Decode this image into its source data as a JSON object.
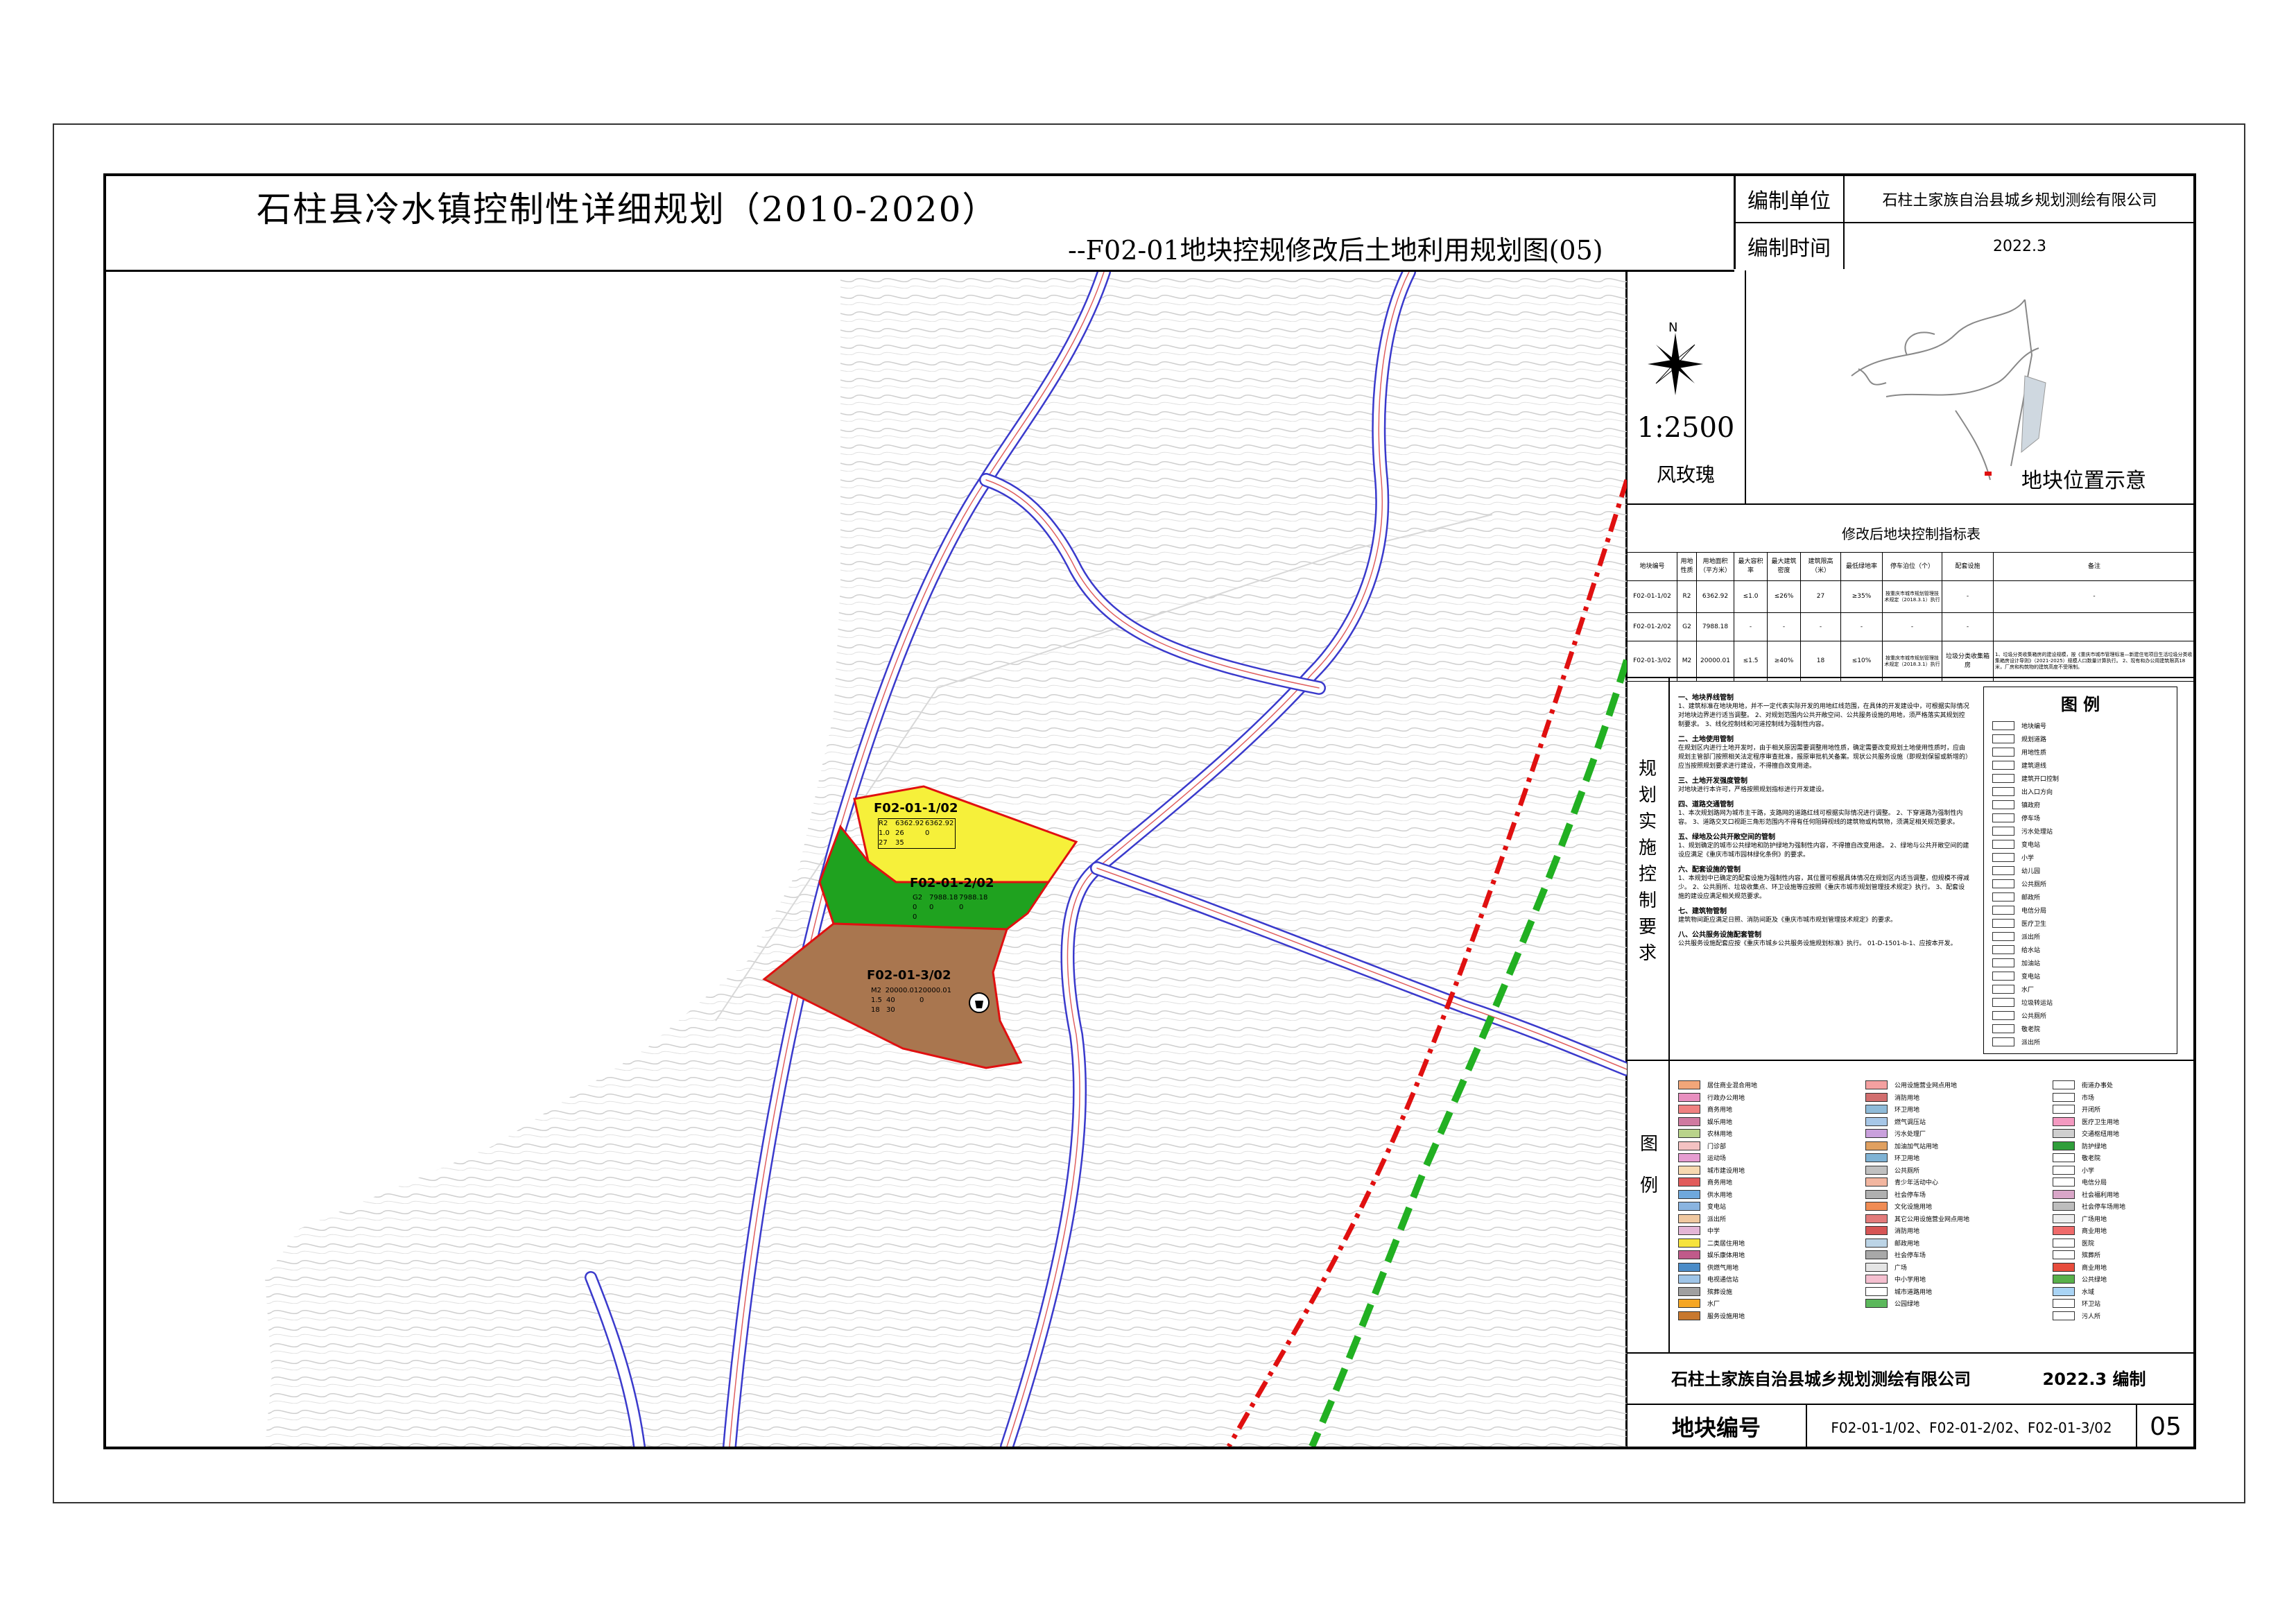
{
  "header": {
    "title": "石柱县冷水镇控制性详细规划（2010-2020）",
    "subtitle": "--F02-01地块控规修改后土地利用规划图(05)",
    "unit_label": "编制单位",
    "unit_value": "石柱土家族自治县城乡规划测绘有限公司",
    "time_label": "编制时间",
    "time_value": "2022.3"
  },
  "compass": {
    "north": "N",
    "scale": "1:2500",
    "label": "风玫瑰"
  },
  "location": {
    "label": "地块位置示意"
  },
  "index_table": {
    "title": "修改后地块控制指标表",
    "headers": [
      "地块编号",
      "用地性质",
      "用地面积（平方米）",
      "最大容积率",
      "最大建筑密度",
      "建筑限高（米）",
      "最低绿地率",
      "停车泊位（个）",
      "配套设施",
      "备注"
    ],
    "rows": [
      [
        "F02-01-1/02",
        "R2",
        "6362.92",
        "≤1.0",
        "≤26%",
        "27",
        "≥35%",
        "按重庆市城市规划管理技术规定（2018.3.1）执行",
        "-",
        "-"
      ],
      [
        "F02-01-2/02",
        "G2",
        "7988.18",
        "-",
        "-",
        "-",
        "-",
        "-",
        "-",
        ""
      ],
      [
        "F02-01-3/02",
        "M2",
        "20000.01",
        "≤1.5",
        "≥40%",
        "18",
        "≤10%",
        "按重庆市城市规划管理技术规定（2018.3.1）执行",
        "垃圾分类收集箱房",
        "1、垃圾分类收集箱房的建设规模，按《重庆市城市管理标准—新建住宅项目生活垃圾分类收集箱房设计导则》（2021-2025）规模人口数量计算执行。 2、现有和办公用建筑限高18米，厂房和构筑物的建筑高度不受限制。"
      ]
    ]
  },
  "requirements": {
    "title": "规划实施控制要求",
    "sections": [
      {
        "h": "一、地块界线管制",
        "t": "1、建筑标准在地块用地，并不一定代表实际开发的用地红线范围，在具体的开发建设中，可根据实际情况对地块边界进行适当调整。 2、对规划范围内公共开敞空间、公共服务设施的用地，须严格落实其规划控制要求。 3、线化控制线和河道控制线为强制性内容。"
      },
      {
        "h": "二、土地使用管制",
        "t": "在规划区内进行土地开发时，由于相关原因需要调整用地性质，确定需要改变规划土地使用性质时，应由规划主管部门按照相关法定程序审查批准，报原审批机关备案。现状公共服务设施（即规划保留或新增的）应当按照规划要求进行建设，不得擅自改变用途。"
      },
      {
        "h": "三、土地开发强度管制",
        "t": "对地块进行本许可，严格按照规划指标进行开发建设。"
      },
      {
        "h": "四、道路交通管制",
        "t": "1、本次规划路网为城市主干路，支路网的道路红线可根据实际情况进行调整。 2、下穿道路为强制性内容。 3、道路交叉口视距三角形范围内不得有任何阻碍视线的建筑物或构筑物，须满足相关规范要求。"
      },
      {
        "h": "五、绿地及公共开敞空间的管制",
        "t": "1、规划确定的城市公共绿地和防护绿地为强制性内容，不得擅自改变用途。 2、绿地与公共开敞空间的建设应满足《重庆市城市园林绿化条例》的要求。"
      },
      {
        "h": "六、配套设施的管制",
        "t": "1、本规划中已确定的配套设施为强制性内容，其位置可根据具体情况在规划区内适当调整，但规模不得减少。 2、公共厕所、垃圾收集点、环卫设施等应按照《重庆市城市规划管理技术规定》执行。 3、配套设施的建设应满足相关规范要求。"
      },
      {
        "h": "七、建筑物管制",
        "t": "建筑物间距应满足日照、消防间距及《重庆市城市规划管理技术规定》的要求。"
      },
      {
        "h": "八、公共服务设施配套管制",
        "t": "公共服务设施配套应按《重庆市城乡公共服务设施规划标准》执行。 01-D-1501-b-1、应按本开发。"
      }
    ]
  },
  "legend_top": {
    "title": "图  例",
    "items": [
      "地块编号",
      "规划道路",
      "用地性质",
      "建筑退线",
      "建筑开口控制",
      "出入口方向",
      "镇政府",
      "停车场",
      "污水处理站",
      "变电站",
      "小学",
      "幼儿园",
      "公共厕所",
      "邮政所",
      "电信分局",
      "医疗卫生",
      "派出所",
      "给水站",
      "加油站",
      "变电站",
      "水厂",
      "垃圾转运站",
      "公共厕所",
      "敬老院",
      "派出所"
    ]
  },
  "legend_bottom": {
    "title": "图    例",
    "col1": [
      {
        "label": "居住商业混合用地",
        "color": "#f2a679"
      },
      {
        "label": "行政办公用地",
        "color": "#e88fbf"
      },
      {
        "label": "商务用地",
        "color": "#f08080"
      },
      {
        "label": "娱乐用地",
        "color": "#d07aa0"
      },
      {
        "label": "农林用地",
        "color": "#b9d38a"
      },
      {
        "label": "门诊部",
        "color": "#f4c2c2"
      },
      {
        "label": "运动场",
        "color": "#e69dd1"
      },
      {
        "label": "城市建设用地",
        "color": "#f7d9b0"
      },
      {
        "label": "商务用地",
        "color": "#e15b5b"
      },
      {
        "label": "供水用地",
        "color": "#6fa8dc"
      },
      {
        "label": "变电站",
        "color": "#8ab4e0"
      },
      {
        "label": "派出所",
        "color": "#f0c8a0"
      },
      {
        "label": "中学",
        "color": "#e4b5d6"
      },
      {
        "label": "二类居住用地",
        "color": "#f6e33c"
      },
      {
        "label": "娱乐康体用地",
        "color": "#c05a8a"
      },
      {
        "label": "供燃气用地",
        "color": "#4b8cc8"
      },
      {
        "label": "电视通信站",
        "color": "#9fc5e8"
      },
      {
        "label": "殡葬设施",
        "color": "#a0a0a0"
      },
      {
        "label": "水厂",
        "color": "#f5a623"
      },
      {
        "label": "服务设施用地",
        "color": "#c8782e"
      }
    ],
    "col2": [
      {
        "label": "公用设施营业网点用地",
        "color": "#f4a0a0"
      },
      {
        "label": "消防用地",
        "color": "#d26e6e"
      },
      {
        "label": "环卫用地",
        "color": "#8fbbd9"
      },
      {
        "label": "燃气调压站",
        "color": "#a7c7e7"
      },
      {
        "label": "污水处理厂",
        "color": "#c9a0dc"
      },
      {
        "label": "加油加气站用地",
        "color": "#e0a060"
      },
      {
        "label": "环卫用地",
        "color": "#7fb3d5"
      },
      {
        "label": "公共厕所",
        "color": "#c0c0c0"
      },
      {
        "label": "青少年活动中心",
        "color": "#f2b6a0"
      },
      {
        "label": "社会停车场",
        "color": "#b0b0b0"
      },
      {
        "label": "文化设施用地",
        "color": "#f08c54"
      },
      {
        "label": "其它公用设施营业网点用地",
        "color": "#e37b7b"
      },
      {
        "label": "消防用地",
        "color": "#d65555"
      },
      {
        "label": "邮政用地",
        "color": "#bcd4e6"
      },
      {
        "label": "社会停车场",
        "color": "#a8a8a8"
      },
      {
        "label": "广场",
        "color": "#e5e5e5"
      },
      {
        "label": "中小学用地",
        "color": "#f5c0d0"
      },
      {
        "label": "城市道路用地",
        "color": "#ffffff"
      },
      {
        "label": "公园绿地",
        "color": "#5cb85c"
      }
    ],
    "col3": [
      {
        "label": "街道办事处",
        "color": "#ffffff"
      },
      {
        "label": "市场",
        "color": "#ffffff"
      },
      {
        "label": "开闭所",
        "color": "#ffffff"
      },
      {
        "label": "医疗卫生用地",
        "color": "#f49ac1"
      },
      {
        "label": "交通枢纽用地",
        "color": "#cfcfcf"
      },
      {
        "label": "防护绿地",
        "color": "#2f9e3a"
      },
      {
        "label": "敬老院",
        "color": "#ffffff"
      },
      {
        "label": "小学",
        "color": "#ffffff"
      },
      {
        "label": "电信分局",
        "color": "#ffffff"
      },
      {
        "label": "社会福利用地",
        "color": "#d9a6c8"
      },
      {
        "label": "社会停车场用地",
        "color": "#bdbdbd"
      },
      {
        "label": "广场用地",
        "color": "#eeeeee"
      },
      {
        "label": "商业用地",
        "color": "#ef6a6a"
      },
      {
        "label": "医院",
        "color": "#ffffff"
      },
      {
        "label": "殡葬所",
        "color": "#ffffff"
      },
      {
        "label": "商业用地",
        "color": "#e74c3c"
      },
      {
        "label": "公共绿地",
        "color": "#58b04a"
      },
      {
        "label": "水域",
        "color": "#a9d4f5"
      },
      {
        "label": "环卫站",
        "color": "#ffffff"
      },
      {
        "label": "污人所",
        "color": "#ffffff"
      }
    ]
  },
  "footer": {
    "company": "石柱土家族自治县城乡规划测绘有限公司",
    "date_note": "2022.3 编制",
    "plot_label": "地块编号",
    "plot_value": "F02-01-1/02、F02-01-2/02、F02-01-3/02",
    "sheet": "05"
  },
  "parcels": [
    {
      "id": "F02-01-1/02",
      "code": "R2",
      "area1": "6362.92",
      "area2": "6362.92",
      "far": "1.0",
      "density": "26",
      "d0": "0",
      "height": "27",
      "green": "35"
    },
    {
      "id": "F02-01-2/02",
      "code": "G2",
      "area1": "7988.18",
      "area2": "7988.18",
      "a": "0",
      "b": "0",
      "c": "0",
      "d": "0"
    },
    {
      "id": "F02-01-3/02",
      "code": "M2",
      "area1": "20000.01",
      "area2": "20000.01",
      "far": "1.5",
      "density": "40",
      "d0": "0",
      "height": "18",
      "green": "30"
    }
  ],
  "colors": {
    "residential": "#f6f03a",
    "green": "#1fa21f",
    "industrial": "#a9764f",
    "road": "#3a3acc",
    "redline": "#e01010",
    "greenline": "#22b022"
  }
}
